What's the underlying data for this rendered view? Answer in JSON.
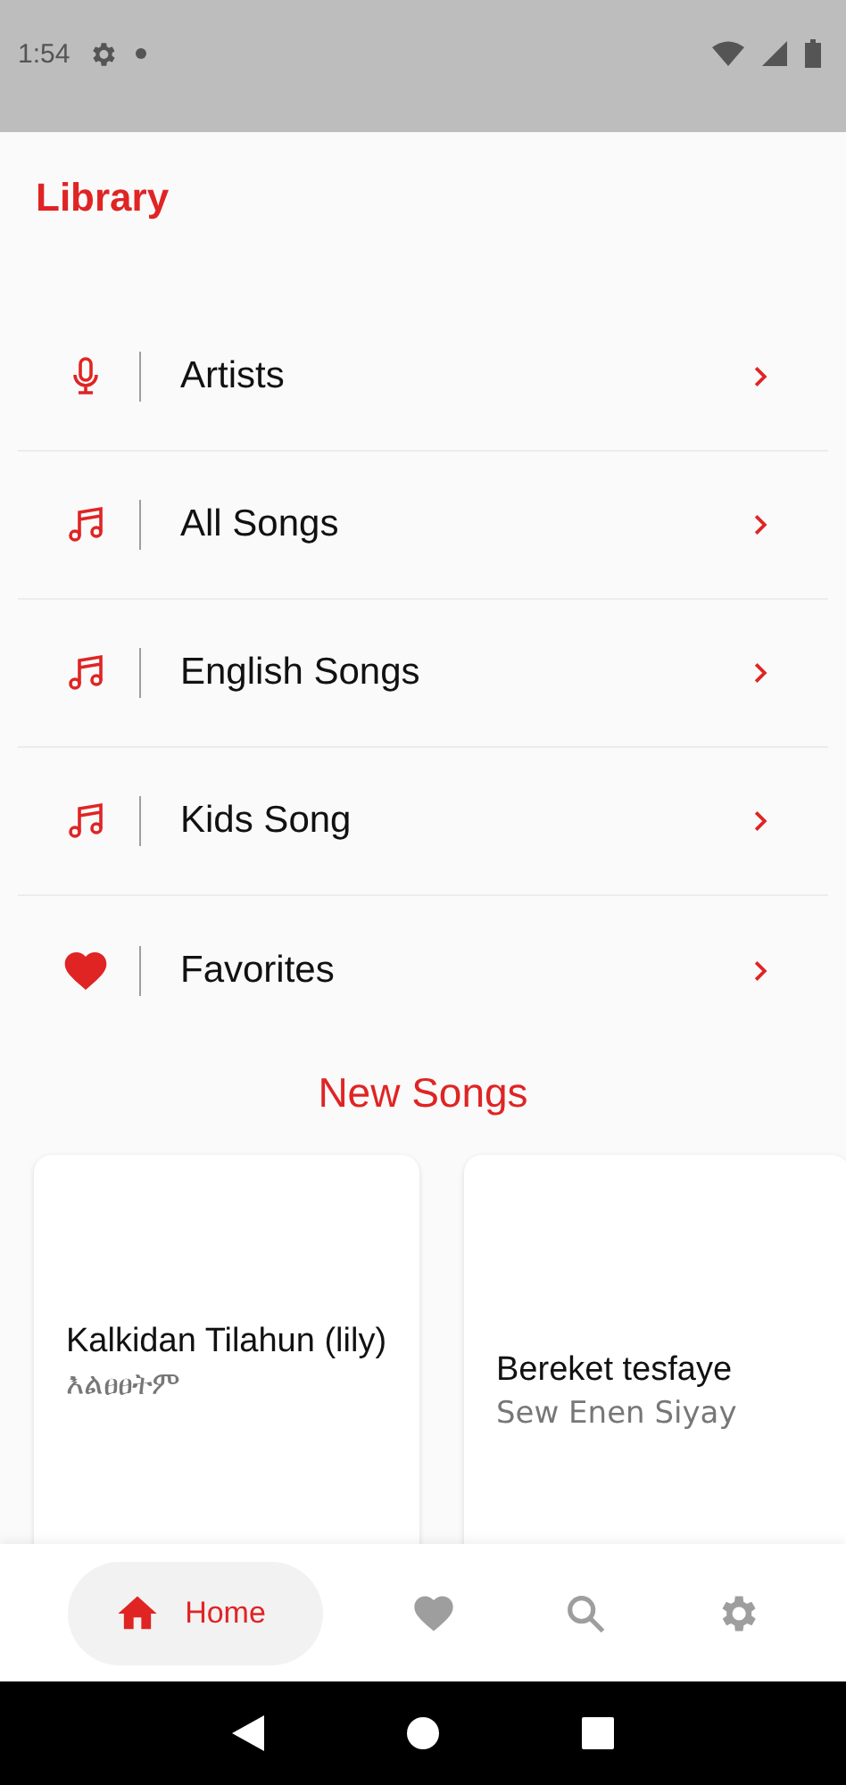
{
  "status_bar": {
    "time": "1:54"
  },
  "header": {
    "title": "Library"
  },
  "menu": [
    {
      "label": "Artists",
      "kind": "mic"
    },
    {
      "label": "All Songs",
      "kind": "note"
    },
    {
      "label": "English Songs",
      "kind": "note"
    },
    {
      "label": "Kids Song",
      "kind": "note"
    },
    {
      "label": "Favorites",
      "kind": "heart"
    }
  ],
  "new_songs": {
    "title": "New Songs",
    "cards": [
      {
        "title": "Kalkidan Tilahun (lily)",
        "subtitle": "እልፀፀትም"
      },
      {
        "title": "Bereket tesfaye",
        "subtitle": "Sew Enen Siyay"
      }
    ]
  },
  "bottom_nav": [
    {
      "kind": "home",
      "label": "Home",
      "selected": true
    },
    {
      "kind": "heart",
      "selected": false
    },
    {
      "kind": "search",
      "selected": false
    },
    {
      "kind": "settings",
      "selected": false
    }
  ]
}
